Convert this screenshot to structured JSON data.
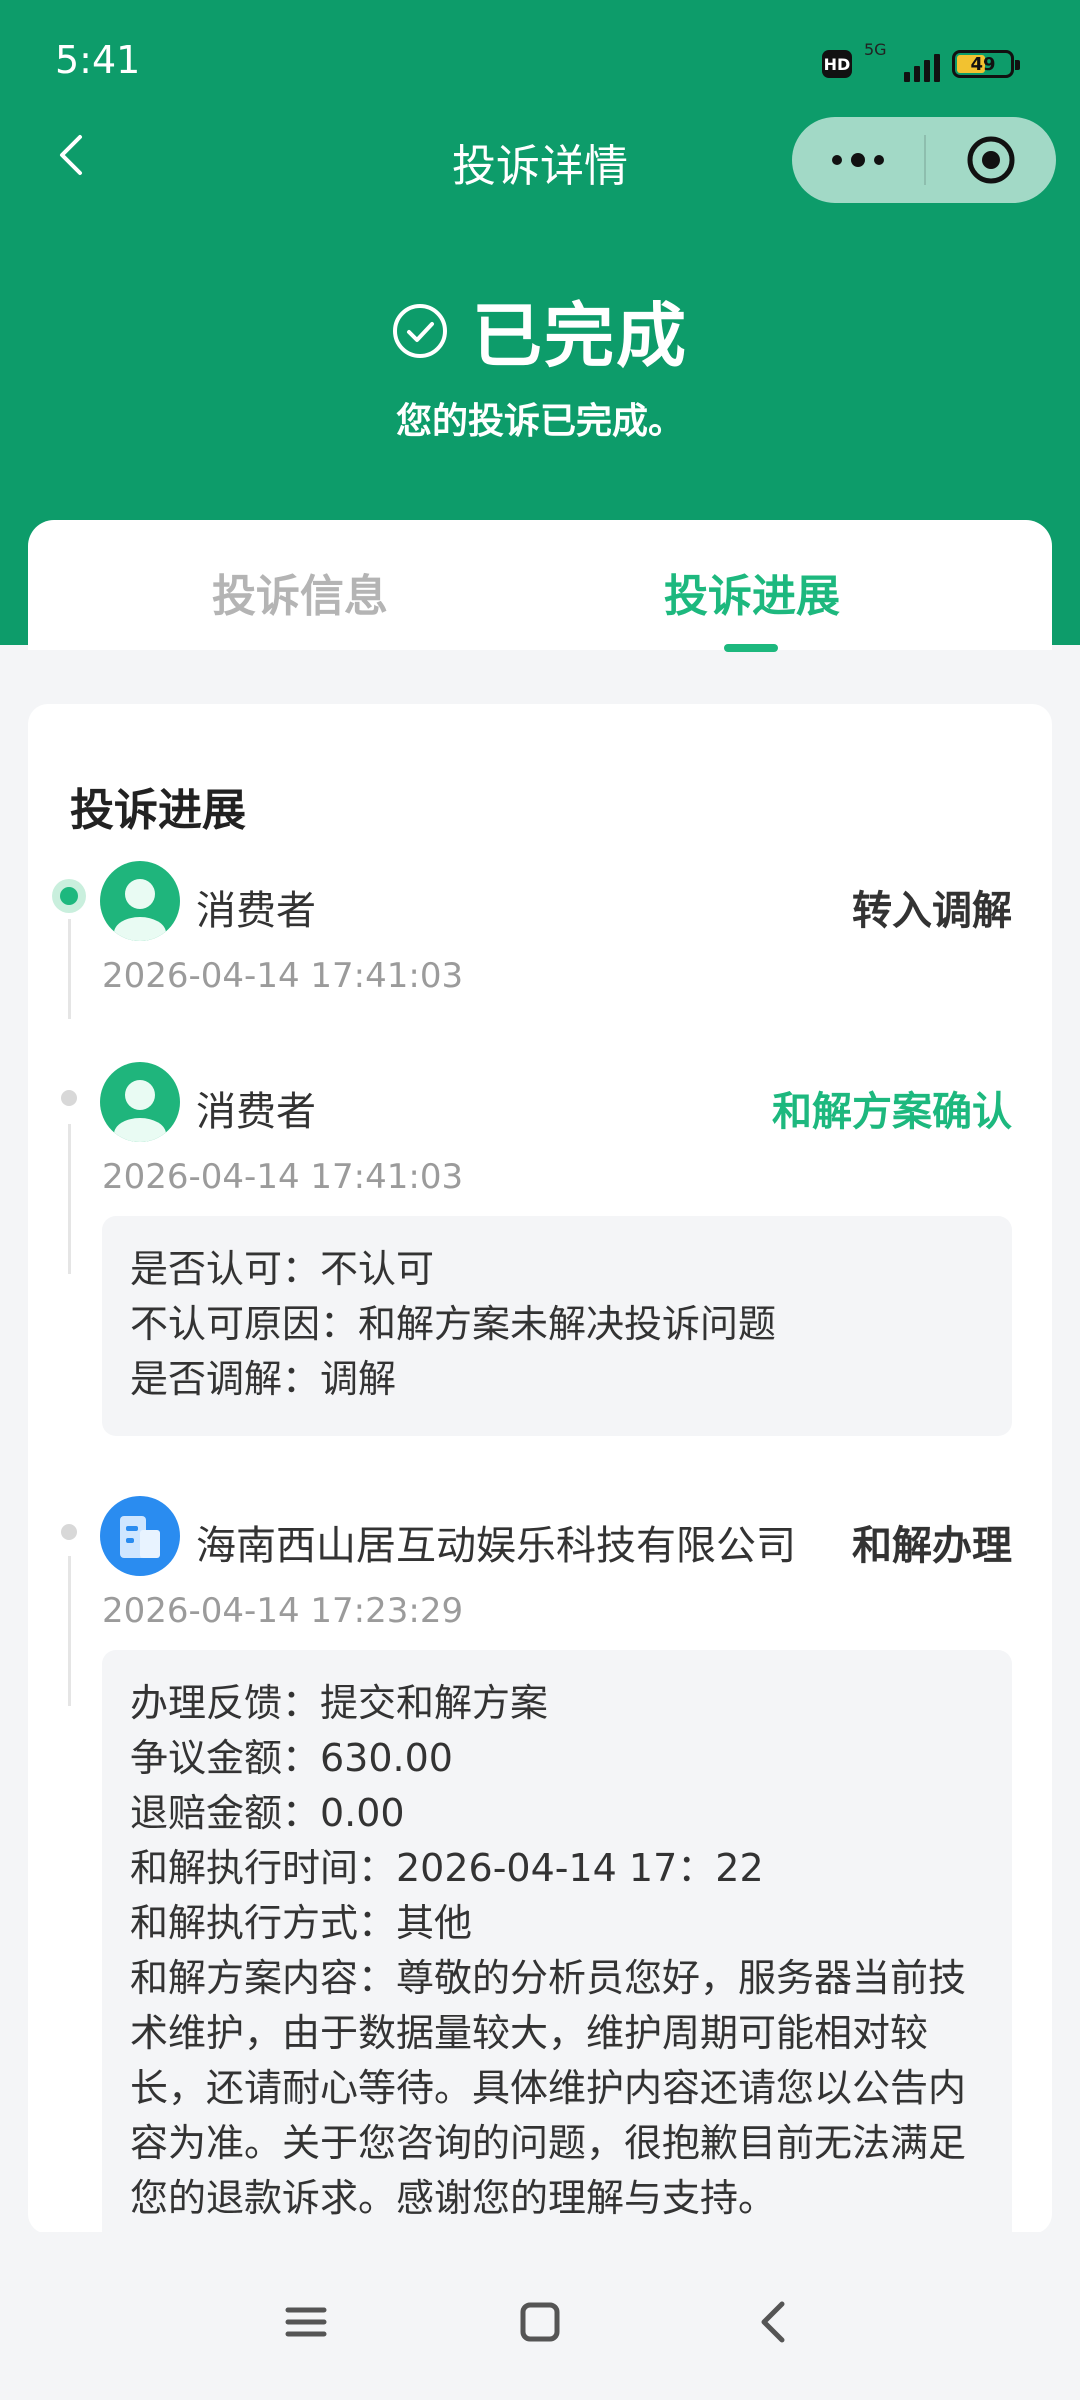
{
  "status_bar": {
    "time": "5:41",
    "hd_label": "HD",
    "network_label": "5G",
    "battery_level": "49",
    "battery_color": "#f2c230"
  },
  "nav": {
    "title": "投诉详情",
    "back_icon": "chevron-left-icon",
    "more_icon": "more-dots-icon",
    "target_icon": "close-target-icon"
  },
  "hero": {
    "status_title": "已完成",
    "status_subtitle": "您的投诉已完成。",
    "status_icon": "check-circle-icon"
  },
  "tabs": [
    {
      "label": "投诉信息",
      "active": false
    },
    {
      "label": "投诉进展",
      "active": true
    }
  ],
  "progress": {
    "section_title": "投诉进展",
    "items": [
      {
        "actor": "消费者",
        "action": "转入调解",
        "time": "2026-04-14 17:41:03",
        "avatar": "person-avatar-icon"
      },
      {
        "actor": "消费者",
        "action": "和解方案确认",
        "time": "2026-04-14 17:41:03",
        "avatar": "person-avatar-icon",
        "details": [
          "是否认可：不认可",
          "不认可原因：和解方案未解决投诉问题",
          "是否调解：调解"
        ]
      },
      {
        "actor": "海南西山居互动娱乐科技有限公司",
        "action": "和解办理",
        "time": "2026-04-14 17:23:29",
        "avatar": "company-building-icon",
        "details": [
          "办理反馈：提交和解方案",
          "争议金额：630.00",
          "退赔金额：0.00",
          "和解执行时间：2026-04-14 17：22",
          "和解执行方式：其他",
          "和解方案内容：尊敬的分析员您好，服务器当前技",
          "术维护，由于数据量较大，维护周期可能相对较",
          "长，还请耐心等待。具体维护内容还请您以公告内",
          "容为准。关于您咨询的问题，很抱歉目前无法满足",
          "您的退款诉求。感谢您的理解与支持。"
        ]
      }
    ]
  },
  "bottom_nav": {
    "menu_icon": "menu-lines-icon",
    "home_icon": "home-square-icon",
    "back_icon": "back-triangle-icon"
  },
  "colors": {
    "brand_green": "#0d9c6a",
    "accent_green": "#1db87e"
  }
}
